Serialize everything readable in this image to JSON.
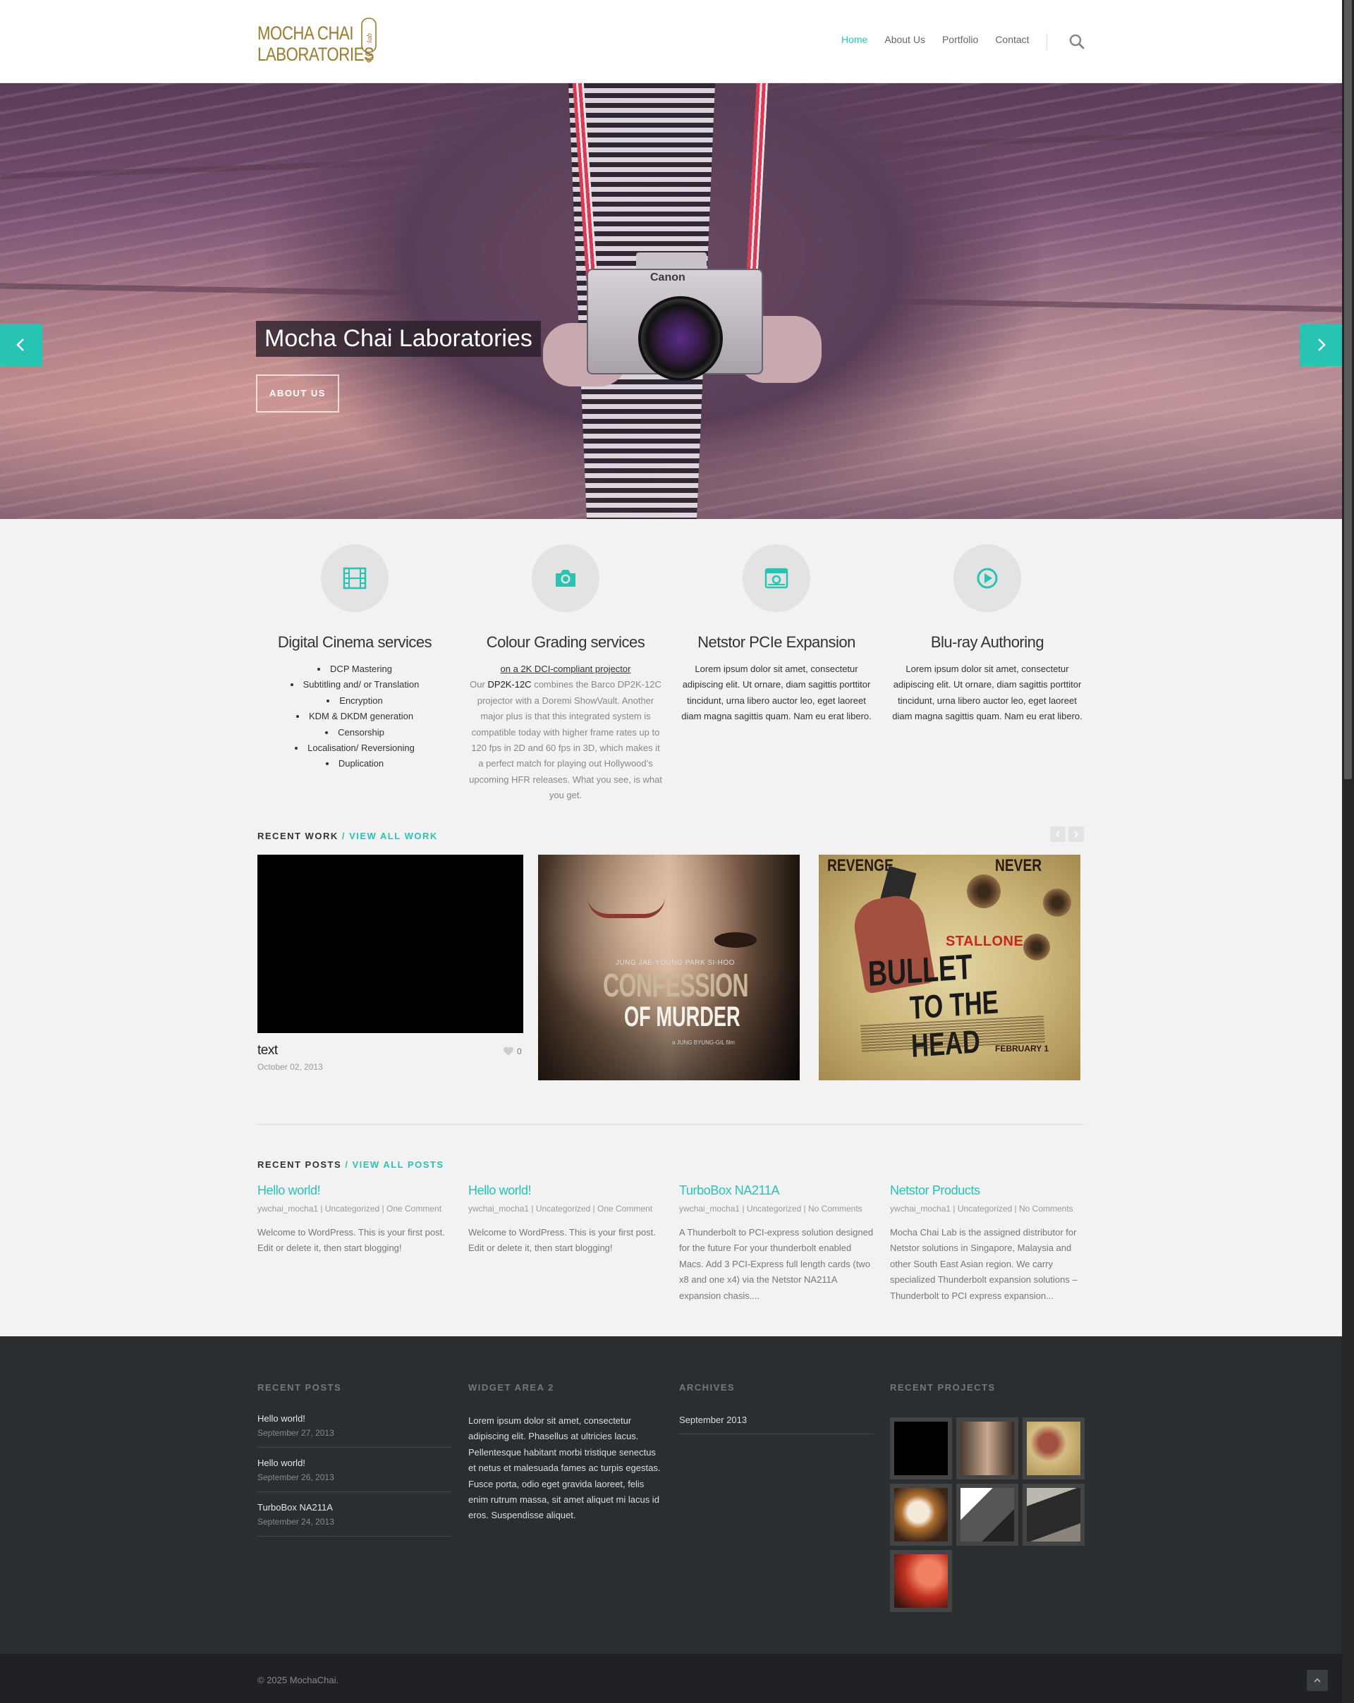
{
  "brand": {
    "logo_line1": "MOCHA CHAI",
    "logo_line2": "LABORATORIES",
    "logo_mark": "lab",
    "accent_color": "#27c4b4",
    "logo_color": "#9c7a2e"
  },
  "nav": {
    "items": [
      {
        "label": "Home",
        "active": true
      },
      {
        "label": "About Us",
        "active": false
      },
      {
        "label": "Portfolio",
        "active": false
      },
      {
        "label": "Contact",
        "active": false
      }
    ],
    "search_icon": "search-icon"
  },
  "hero": {
    "title": "Mocha Chai Laboratories",
    "button": "ABOUT US",
    "camera_brand": "Canon",
    "prev_icon": "chevron-left-icon",
    "next_icon": "chevron-right-icon"
  },
  "services": [
    {
      "icon": "film-icon",
      "title": "Digital Cinema services",
      "items": [
        "DCP Mastering",
        "Subtitling and/ or Translation",
        "Encryption",
        "KDM & DKDM generation",
        "Censorship",
        "Localisation/ Reversioning",
        "Duplication"
      ]
    },
    {
      "icon": "camera-icon",
      "title": "Colour Grading services",
      "link": "on a 2K DCI-compliant projector",
      "text_prefix": "Our",
      "text_strong": "DP2K-12C",
      "text": "combines the Barco DP2K-12C projector with a Doremi ShowVault. Another major plus is that this integrated system is compatible today with higher frame rates up to 120 fps in 2D and 60 fps in 3D, which makes it a perfect match for playing out Hollywood’s upcoming HFR releases. What you see, is what you get."
    },
    {
      "icon": "photo-icon",
      "title": "Netstor PCIe Expansion",
      "text": "Lorem ipsum dolor sit amet, consectetur adipiscing elit. Ut ornare, diam sagittis porttitor tincidunt, urna libero auctor leo, eget laoreet diam magna sagittis quam. Nam eu erat libero."
    },
    {
      "icon": "play-icon",
      "title": "Blu-ray Authoring",
      "text": "Lorem ipsum dolor sit amet, consectetur adipiscing elit. Ut ornare, diam sagittis porttitor tincidunt, urna libero auctor leo, eget laoreet diam magna sagittis quam. Nam eu erat libero."
    }
  ],
  "recent_work": {
    "heading": "RECENT WORK",
    "link": "/ VIEW ALL WORK",
    "item": {
      "title": "text",
      "date": "October 02, 2013",
      "likes": "0"
    },
    "poster1": {
      "names": "JUNG JAE-YOUNG    PARK SI-HOO",
      "title_1": "CONFESSION",
      "title_2": "OF MURDER",
      "sub": "a JUNG BYUNG-GIL film"
    },
    "poster2": {
      "top_left": "REVENGE",
      "top_right": "NEVER",
      "star": "STALLONE",
      "title_1": "BULLET",
      "title_2": "TO THE HEAD",
      "date": "FEBRUARY 1"
    }
  },
  "recent_posts": {
    "heading": "RECENT POSTS",
    "link": "/ VIEW ALL POSTS",
    "posts": [
      {
        "title": "Hello world!",
        "meta": "ywchai_mocha1 | Uncategorized | One Comment",
        "excerpt": "Welcome to WordPress. This is your first post. Edit or delete it, then start blogging!"
      },
      {
        "title": "Hello world!",
        "meta": "ywchai_mocha1 | Uncategorized | One Comment",
        "excerpt": "Welcome to WordPress. This is your first post. Edit or delete it, then start blogging!"
      },
      {
        "title": "TurboBox NA211A",
        "meta": "ywchai_mocha1 | Uncategorized | No Comments",
        "excerpt": "A Thunderbolt to PCI-express solution designed for the future For your thunderbolt enabled Macs. Add 3 PCI-Express full length cards (two x8 and one x4) via the Netstor NA211A expansion chasis...."
      },
      {
        "title": "Netstor Products",
        "meta": "ywchai_mocha1 | Uncategorized | No Comments",
        "excerpt": "Mocha Chai Lab is the assigned distributor for Netstor solutions in Singapore, Malaysia and other South East Asian region. We carry specialized Thunderbolt expansion solutions – Thunderbolt to PCI express expansion..."
      }
    ]
  },
  "footer": {
    "recent_posts": {
      "heading": "RECENT POSTS",
      "items": [
        {
          "title": "Hello world!",
          "date": "September 27, 2013"
        },
        {
          "title": "Hello world!",
          "date": "September 26, 2013"
        },
        {
          "title": "TurboBox NA211A",
          "date": "September 24, 2013"
        }
      ]
    },
    "widget": {
      "heading": "WIDGET AREA 2",
      "text": "Lorem ipsum dolor sit amet, consectetur adipiscing elit. Phasellus at ultricies lacus. Pellentesque habitant morbi tristique senectus et netus et malesuada fames ac turpis egestas. Fusce porta, odio eget gravida laoreet, felis enim rutrum massa, sit amet aliquet mi lacus id eros. Suspendisse aliquet."
    },
    "archives": {
      "heading": "ARCHIVES",
      "items": [
        "September 2013"
      ]
    },
    "projects": {
      "heading": "RECENT PROJECTS",
      "count": 7
    },
    "copyright": "© 2025 MochaChai.",
    "to_top_icon": "chevron-up-icon"
  }
}
